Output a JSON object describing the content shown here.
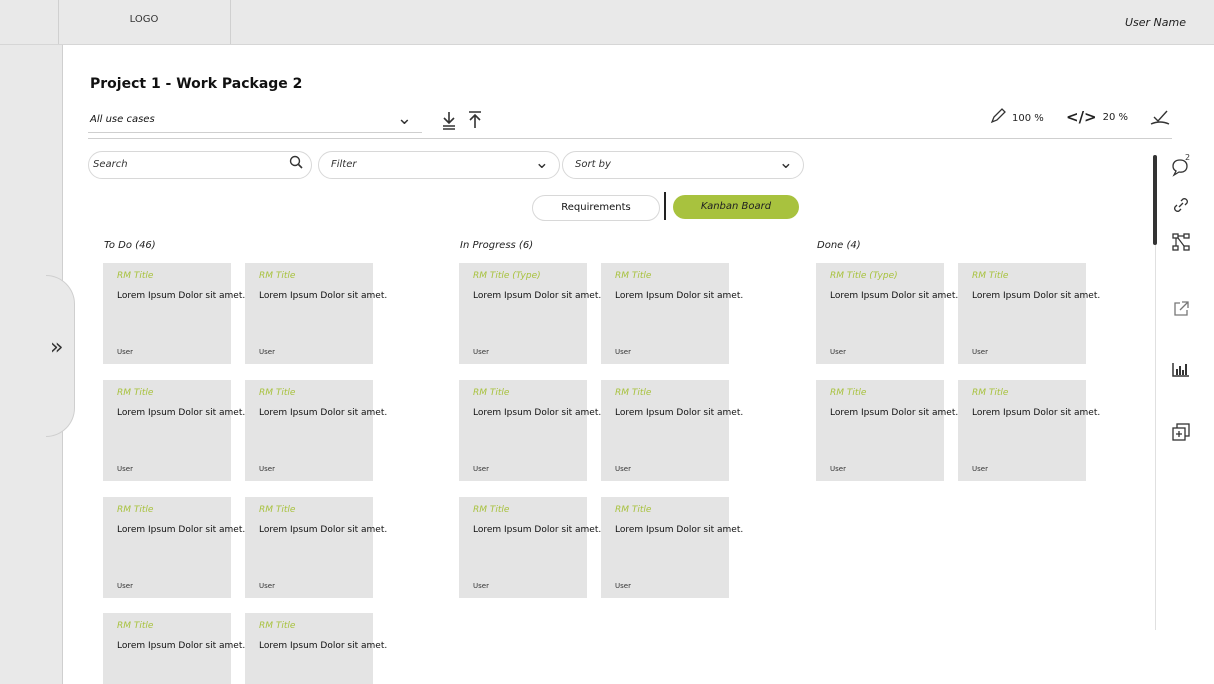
{
  "header": {
    "logo": "LOGO",
    "user_name": "User Name"
  },
  "project": {
    "title": "Project 1 - Work Package 2"
  },
  "toolbar": {
    "use_case_select": "All use cases",
    "progress_edit": "100 %",
    "progress_code": "20 %"
  },
  "filters": {
    "search_placeholder": "Search",
    "filter_placeholder": "Filter",
    "sort_placeholder": "Sort by"
  },
  "view_toggle": {
    "requirements": "Requirements",
    "kanban": "Kanban Board",
    "active": "Kanban Board"
  },
  "colors": {
    "accent": "#a8c23e",
    "card_bg": "#e4e4e4",
    "chrome_bg": "#e9e9e9"
  },
  "board": {
    "columns": [
      {
        "title": "To Do (46)",
        "cards": [
          {
            "title": "RM Title",
            "desc": "Lorem Ipsum Dolor sit amet.",
            "user": "User"
          },
          {
            "title": "RM Title",
            "desc": "Lorem Ipsum Dolor sit amet.",
            "user": "User"
          },
          {
            "title": "RM Title",
            "desc": "Lorem Ipsum Dolor sit amet.",
            "user": "User"
          },
          {
            "title": "RM Title",
            "desc": "Lorem Ipsum Dolor sit amet.",
            "user": "User"
          },
          {
            "title": "RM Title",
            "desc": "Lorem Ipsum Dolor sit amet.",
            "user": "User"
          },
          {
            "title": "RM Title",
            "desc": "Lorem Ipsum Dolor sit amet.",
            "user": "User"
          },
          {
            "title": "RM Title",
            "desc": "Lorem Ipsum Dolor sit amet.",
            "user": ""
          },
          {
            "title": "RM Title",
            "desc": "Lorem Ipsum Dolor sit amet.",
            "user": ""
          }
        ]
      },
      {
        "title": "In Progress (6)",
        "cards": [
          {
            "title": "RM Title (Type)",
            "desc": "Lorem Ipsum Dolor sit amet.",
            "user": "User"
          },
          {
            "title": "RM Title",
            "desc": "Lorem Ipsum Dolor sit amet.",
            "user": "User"
          },
          {
            "title": "RM Title",
            "desc": "Lorem Ipsum Dolor sit amet.",
            "user": "User"
          },
          {
            "title": "RM Title",
            "desc": "Lorem Ipsum Dolor sit amet.",
            "user": "User"
          },
          {
            "title": "RM Title",
            "desc": "Lorem Ipsum Dolor sit amet.",
            "user": "User"
          },
          {
            "title": "RM Title",
            "desc": "Lorem Ipsum Dolor sit amet.",
            "user": "User"
          }
        ]
      },
      {
        "title": "Done (4)",
        "cards": [
          {
            "title": "RM Title (Type)",
            "desc": "Lorem Ipsum Dolor sit amet.",
            "user": "User"
          },
          {
            "title": "RM Title",
            "desc": "Lorem Ipsum Dolor sit amet.",
            "user": "User"
          },
          {
            "title": "RM Title",
            "desc": "Lorem Ipsum Dolor sit amet.",
            "user": "User"
          },
          {
            "title": "RM Title",
            "desc": "Lorem Ipsum Dolor sit amet.",
            "user": "User"
          }
        ]
      }
    ]
  },
  "rail": {
    "comment_badge": "2",
    "icons": [
      "comment-icon",
      "link-icon",
      "hierarchy-icon",
      "external-link-icon",
      "bar-chart-icon",
      "add-layer-icon"
    ]
  }
}
